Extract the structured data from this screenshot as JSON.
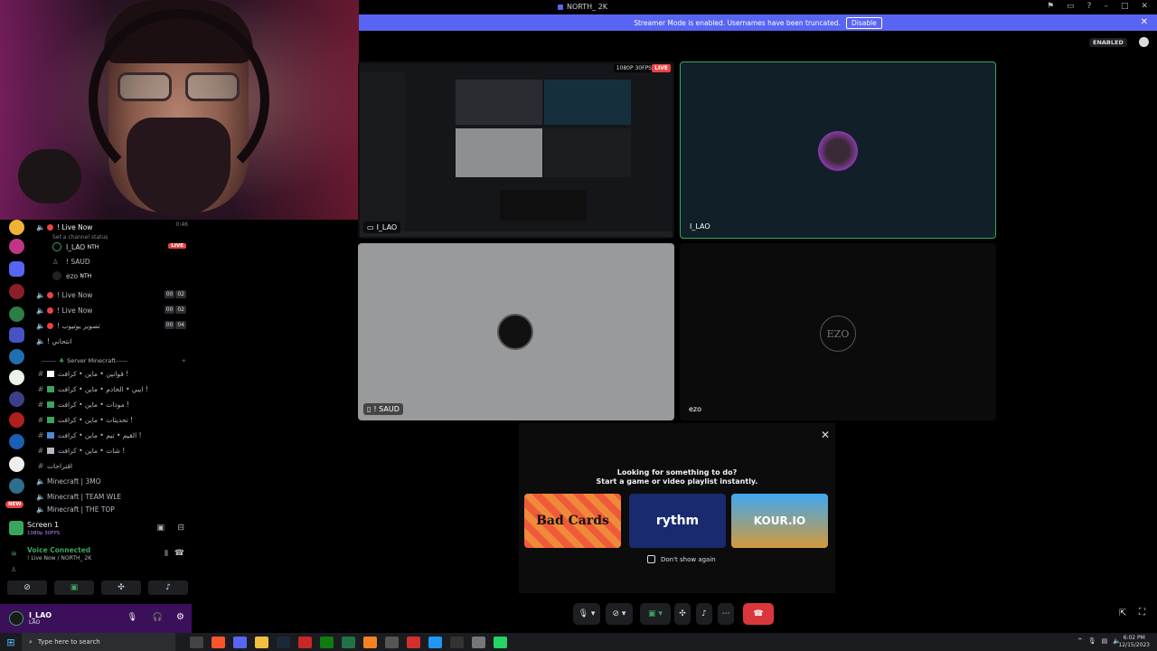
{
  "window": {
    "title": "NORTH_ 2K",
    "banner_text": "Streamer Mode is enabled. Usernames have been truncated.",
    "banner_button": "Disable",
    "enabled_badge": "ENABLED"
  },
  "streams": {
    "tile1": {
      "name": "I_LAO",
      "quality": "1080P 30FPS",
      "live": "LIVE"
    },
    "tile2": {
      "name": "I_LAO"
    },
    "tile3": {
      "name": "! SAUD"
    },
    "tile4": {
      "name": "ezo",
      "avatar_text": "EZO"
    }
  },
  "sidebar": {
    "live_channel": {
      "label": "! Live Now",
      "status": "Set a channel status",
      "timer": "0:46"
    },
    "members": [
      {
        "name": "I_LAO",
        "tag": "NTH",
        "live": "LIVE"
      },
      {
        "name": "! SAUD"
      },
      {
        "name": "ezo",
        "tag": "NTH"
      }
    ],
    "voice_channels": [
      {
        "label": "! Live Now",
        "count1": "00",
        "count2": "02"
      },
      {
        "label": "! Live Now",
        "count1": "00",
        "count2": "02"
      },
      {
        "label": "! تصوير يوتيوب",
        "count1": "00",
        "count2": "04"
      },
      {
        "label": "! انتحاني"
      }
    ],
    "category": "Server Minecraft",
    "text_channels": [
      "قوانين • ماين • كرافت !",
      "ايبي • الخادم • ماين • كرافت !",
      "مودات • ماين • كرافت !",
      "تحديثات • ماين • كرافت !",
      "القيم • تيم • ماين • كرافت !",
      "شات • ماين • كرافت !",
      "اقتراحات"
    ],
    "mc_channels": [
      "Minecraft | 3MO",
      "Minecraft | TEAM WLE",
      "Minecraft | THE TOP"
    ],
    "screen": {
      "title": "Screen 1",
      "sub": "1080p 30FPS"
    },
    "voice": {
      "status": "Voice Connected",
      "location": "! Live Now / NORTH_ 2K"
    },
    "user": {
      "name": "I_LAO",
      "sub": "LAO"
    },
    "new_badge": "NEW"
  },
  "activity": {
    "line1": "Looking for something to do?",
    "line2": "Start a game or video playlist instantly.",
    "cards": [
      "Bad Cards",
      "rythm",
      "KOUR.IO"
    ],
    "dont_show": "Don't show again"
  },
  "taskbar": {
    "search_placeholder": "Type here to search",
    "time": "6:02 PM",
    "date": "12/15/2023"
  }
}
